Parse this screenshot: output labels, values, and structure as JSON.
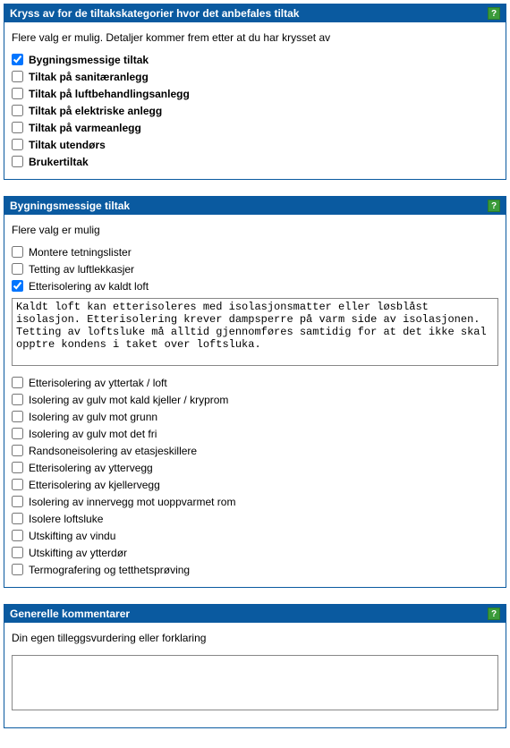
{
  "section1": {
    "title": "Kryss av for de tiltakskategorier hvor det anbefales tiltak",
    "hint": "Flere valg er mulig. Detaljer kommer frem etter at du har krysset av",
    "items": [
      {
        "label": "Bygningsmessige tiltak",
        "checked": true
      },
      {
        "label": "Tiltak på sanitæranlegg",
        "checked": false
      },
      {
        "label": "Tiltak på luftbehandlingsanlegg",
        "checked": false
      },
      {
        "label": "Tiltak på elektriske anlegg",
        "checked": false
      },
      {
        "label": "Tiltak på varmeanlegg",
        "checked": false
      },
      {
        "label": "Tiltak utendørs",
        "checked": false
      },
      {
        "label": "Brukertiltak",
        "checked": false
      }
    ]
  },
  "section2": {
    "title": "Bygningsmessige tiltak",
    "hint": "Flere valg er mulig",
    "itemsTop": [
      {
        "label": "Montere tetningslister",
        "checked": false
      },
      {
        "label": "Tetting av luftlekkasjer",
        "checked": false
      },
      {
        "label": "Etterisolering av kaldt loft",
        "checked": true
      }
    ],
    "detailText": "Kaldt loft kan etterisoleres med isolasjonsmatter eller løsblåst isolasjon. Etterisolering krever dampsperre på varm side av isolasjonen. Tetting av loftsluke må alltid gjennomføres samtidig for at det ikke skal opptre kondens i taket over loftsluka.",
    "itemsBottom": [
      {
        "label": "Etterisolering av yttertak / loft",
        "checked": false
      },
      {
        "label": "Isolering av gulv mot kald kjeller / kryprom",
        "checked": false
      },
      {
        "label": "Isolering av gulv mot grunn",
        "checked": false
      },
      {
        "label": "Isolering av gulv mot det fri",
        "checked": false
      },
      {
        "label": "Randsoneisolering av etasjeskillere",
        "checked": false
      },
      {
        "label": "Etterisolering av yttervegg",
        "checked": false
      },
      {
        "label": "Etterisolering av kjellervegg",
        "checked": false
      },
      {
        "label": "Isolering av innervegg mot uoppvarmet rom",
        "checked": false
      },
      {
        "label": "Isolere loftsluke",
        "checked": false
      },
      {
        "label": "Utskifting av vindu",
        "checked": false
      },
      {
        "label": "Utskifting av ytterdør",
        "checked": false
      },
      {
        "label": "Termografering og tetthetsprøving",
        "checked": false
      }
    ]
  },
  "section3": {
    "title": "Generelle kommentarer",
    "hint": "Din egen tilleggsvurdering eller forklaring",
    "value": ""
  },
  "helpGlyph": "?"
}
